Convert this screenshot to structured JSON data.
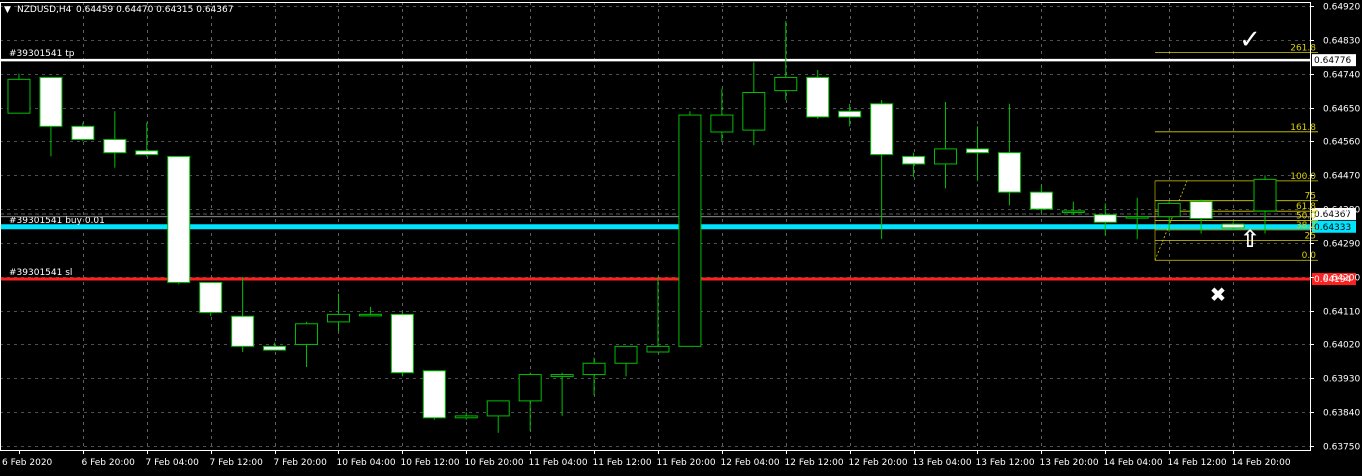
{
  "header": {
    "symbol": "NZDUSD,H4",
    "ohlc": "0.64459 0.64470 0.64315 0.64367"
  },
  "colors": {
    "background": "#000000",
    "bull_candle_body": "#000000",
    "bear_candle_body": "#ffffff",
    "wick": "#00c000",
    "grid": "#9aa0a6",
    "tp_line": "#ffffff",
    "entry_line": "#00e5ff",
    "sl_line": "#ff2020",
    "fib": "#d8d000",
    "axis_text": "#ffffff"
  },
  "chart_data": {
    "type": "candlestick",
    "y_range": [
      0.6375,
      0.6492
    ],
    "y_ticks": [
      "0.64920",
      "0.64830",
      "0.64740",
      "0.64650",
      "0.64560",
      "0.64470",
      "0.64380",
      "0.64290",
      "0.64200",
      "0.64110",
      "0.64020",
      "0.63930",
      "0.63840",
      "0.63750"
    ],
    "x_labels": [
      "6 Feb 2020",
      "6 Feb 20:00",
      "7 Feb 04:00",
      "7 Feb 12:00",
      "7 Feb 20:00",
      "10 Feb 04:00",
      "10 Feb 12:00",
      "10 Feb 20:00",
      "11 Feb 04:00",
      "11 Feb 12:00",
      "11 Feb 20:00",
      "12 Feb 04:00",
      "12 Feb 12:00",
      "12 Feb 20:00",
      "13 Feb 04:00",
      "13 Feb 12:00",
      "13 Feb 20:00",
      "14 Feb 04:00",
      "14 Feb 12:00",
      "14 Feb 20:00"
    ],
    "grid": true,
    "candles": [
      {
        "o": 0.64635,
        "h": 0.6474,
        "l": 0.64635,
        "c": 0.64725
      },
      {
        "o": 0.6473,
        "h": 0.6473,
        "l": 0.6452,
        "c": 0.646
      },
      {
        "o": 0.646,
        "h": 0.6461,
        "l": 0.6456,
        "c": 0.64565
      },
      {
        "o": 0.64565,
        "h": 0.6464,
        "l": 0.6449,
        "c": 0.6453
      },
      {
        "o": 0.64535,
        "h": 0.6461,
        "l": 0.6452,
        "c": 0.64525
      },
      {
        "o": 0.6452,
        "h": 0.6452,
        "l": 0.6418,
        "c": 0.64185
      },
      {
        "o": 0.64185,
        "h": 0.64185,
        "l": 0.64095,
        "c": 0.64105
      },
      {
        "o": 0.64095,
        "h": 0.642,
        "l": 0.64,
        "c": 0.64015
      },
      {
        "o": 0.64015,
        "h": 0.64025,
        "l": 0.64005,
        "c": 0.64005
      },
      {
        "o": 0.6402,
        "h": 0.6408,
        "l": 0.6396,
        "c": 0.64075
      },
      {
        "o": 0.6408,
        "h": 0.64155,
        "l": 0.64055,
        "c": 0.641
      },
      {
        "o": 0.641,
        "h": 0.6412,
        "l": 0.64095,
        "c": 0.641
      },
      {
        "o": 0.641,
        "h": 0.64105,
        "l": 0.63935,
        "c": 0.63945
      },
      {
        "o": 0.6395,
        "h": 0.6395,
        "l": 0.6382,
        "c": 0.63825
      },
      {
        "o": 0.63825,
        "h": 0.6384,
        "l": 0.6382,
        "c": 0.6383
      },
      {
        "o": 0.6383,
        "h": 0.6387,
        "l": 0.63785,
        "c": 0.6387
      },
      {
        "o": 0.6387,
        "h": 0.63945,
        "l": 0.6379,
        "c": 0.6394
      },
      {
        "o": 0.63935,
        "h": 0.63945,
        "l": 0.6383,
        "c": 0.6394
      },
      {
        "o": 0.6394,
        "h": 0.63985,
        "l": 0.63885,
        "c": 0.6397
      },
      {
        "o": 0.6397,
        "h": 0.64015,
        "l": 0.63935,
        "c": 0.64015
      },
      {
        "o": 0.64,
        "h": 0.642,
        "l": 0.64,
        "c": 0.64015
      },
      {
        "o": 0.64015,
        "h": 0.6464,
        "l": 0.64015,
        "c": 0.6463
      },
      {
        "o": 0.64585,
        "h": 0.647,
        "l": 0.6456,
        "c": 0.6463
      },
      {
        "o": 0.6459,
        "h": 0.6477,
        "l": 0.6455,
        "c": 0.6469
      },
      {
        "o": 0.64695,
        "h": 0.6488,
        "l": 0.6467,
        "c": 0.6473
      },
      {
        "o": 0.6473,
        "h": 0.6475,
        "l": 0.6462,
        "c": 0.64625
      },
      {
        "o": 0.6464,
        "h": 0.6466,
        "l": 0.646,
        "c": 0.64625
      },
      {
        "o": 0.6466,
        "h": 0.6467,
        "l": 0.643,
        "c": 0.64525
      },
      {
        "o": 0.6452,
        "h": 0.6453,
        "l": 0.64465,
        "c": 0.645
      },
      {
        "o": 0.645,
        "h": 0.64665,
        "l": 0.64435,
        "c": 0.6454
      },
      {
        "o": 0.6454,
        "h": 0.646,
        "l": 0.64455,
        "c": 0.6453
      },
      {
        "o": 0.6453,
        "h": 0.6466,
        "l": 0.6439,
        "c": 0.64425
      },
      {
        "o": 0.64425,
        "h": 0.64445,
        "l": 0.6437,
        "c": 0.6438
      },
      {
        "o": 0.64375,
        "h": 0.644,
        "l": 0.64365,
        "c": 0.64375
      },
      {
        "o": 0.64365,
        "h": 0.64395,
        "l": 0.6431,
        "c": 0.64345
      },
      {
        "o": 0.6436,
        "h": 0.6441,
        "l": 0.643,
        "c": 0.6436
      },
      {
        "o": 0.6436,
        "h": 0.644,
        "l": 0.6432,
        "c": 0.64395
      },
      {
        "o": 0.644,
        "h": 0.64405,
        "l": 0.64315,
        "c": 0.64355
      },
      {
        "o": 0.6434,
        "h": 0.64345,
        "l": 0.64325,
        "c": 0.6433
      },
      {
        "o": 0.64375,
        "h": 0.6447,
        "l": 0.64315,
        "c": 0.64459
      }
    ],
    "levels": [
      {
        "name": "tp",
        "label": "#39301541 tp",
        "price": 0.64776,
        "tag": "0.64776"
      },
      {
        "name": "buy",
        "label": "#39301541 buy 0.01",
        "price": 0.64333,
        "tag": "0.64333"
      },
      {
        "name": "sl",
        "label": "#39301541 sl",
        "price": 0.64194,
        "tag": "0.64194"
      }
    ],
    "current_price": {
      "price": 0.64367,
      "tag": "0.64367"
    },
    "fib_low": 0.64244,
    "fib_high": 0.64455,
    "fib_levels": [
      {
        "ratio": 0.0,
        "label": "0.0"
      },
      {
        "ratio": 0.25,
        "label": "25"
      },
      {
        "ratio": 0.382,
        "label": "38.2"
      },
      {
        "ratio": 0.5,
        "label": "50.0"
      },
      {
        "ratio": 0.618,
        "label": "61.8"
      },
      {
        "ratio": 0.75,
        "label": "75"
      },
      {
        "ratio": 1.0,
        "label": "100.0"
      },
      {
        "ratio": 1.618,
        "label": "161.8"
      },
      {
        "ratio": 2.618,
        "label": "261.8"
      }
    ],
    "annotations": [
      {
        "name": "checkmark-icon",
        "glyph": "✓",
        "price": 0.6483
      },
      {
        "name": "cross-icon",
        "glyph": "✖",
        "price": 0.64155
      },
      {
        "name": "up-arrow-icon",
        "glyph": "⇧",
        "price": 0.643
      }
    ]
  }
}
